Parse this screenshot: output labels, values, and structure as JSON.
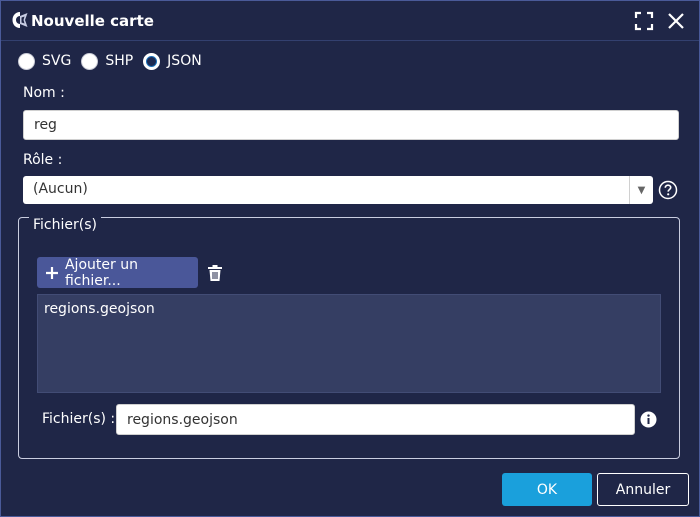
{
  "dialog": {
    "title": "Nouvelle carte",
    "title_icon": "map-app-icon",
    "maximize_icon": "maximize-icon",
    "close_icon": "close-icon"
  },
  "format": {
    "options": [
      {
        "label": "SVG",
        "checked": false
      },
      {
        "label": "SHP",
        "checked": false
      },
      {
        "label": "JSON",
        "checked": true
      }
    ]
  },
  "name": {
    "label": "Nom :",
    "value": "reg"
  },
  "role": {
    "label": "Rôle :",
    "value": "(Aucun)"
  },
  "files": {
    "legend": "Fichier(s)",
    "add_label": "Ajouter un fichier...",
    "items": [
      "regions.geojson"
    ],
    "field_label": "Fichier(s) :",
    "field_value": "regions.geojson"
  },
  "footer": {
    "ok_label": "OK",
    "cancel_label": "Annuler"
  },
  "colors": {
    "background": "#1f2647",
    "ok_button": "#1aa0dc",
    "add_button": "#4a5799",
    "file_list": "#353e63"
  }
}
